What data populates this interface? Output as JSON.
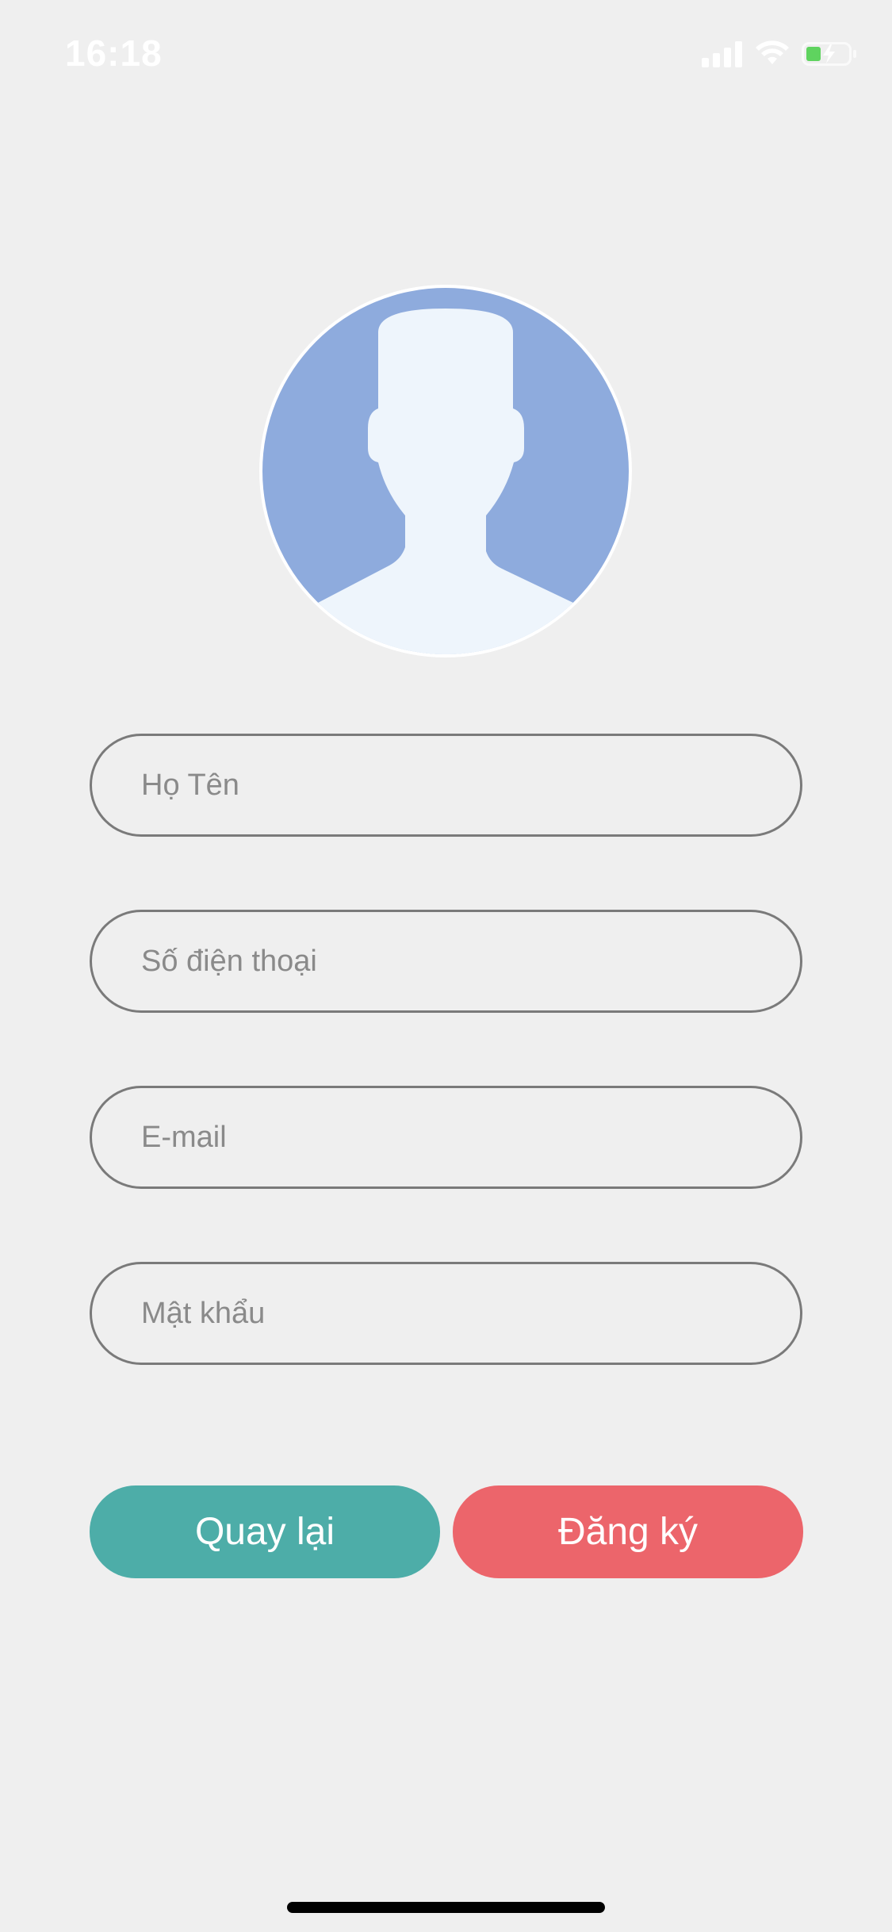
{
  "status_bar": {
    "time": "16:18",
    "signal_icon": "signal-bars-icon",
    "wifi_icon": "wifi-icon",
    "battery_icon": "battery-charging-icon"
  },
  "avatar": {
    "icon": "default-user-avatar-icon",
    "colors": {
      "background": "#8eabdd",
      "silhouette": "#eef5fc",
      "border": "#ffffff"
    }
  },
  "form": {
    "name_placeholder": "Họ Tên",
    "name_value": "",
    "phone_placeholder": "Số điện thoại",
    "phone_value": "",
    "email_placeholder": "E-mail",
    "email_value": "",
    "password_placeholder": "Mật khẩu",
    "password_value": ""
  },
  "buttons": {
    "back_label": "Quay lại",
    "back_color": "#4dada8",
    "register_label": "Đăng ký",
    "register_color": "#ec656b"
  }
}
